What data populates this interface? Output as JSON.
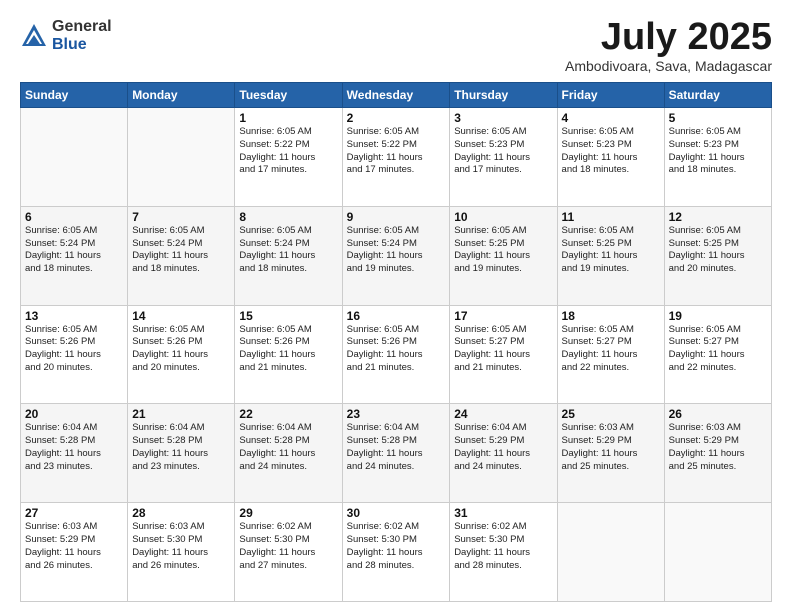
{
  "logo": {
    "general": "General",
    "blue": "Blue"
  },
  "title": "July 2025",
  "location": "Ambodivoara, Sava, Madagascar",
  "weekdays": [
    "Sunday",
    "Monday",
    "Tuesday",
    "Wednesday",
    "Thursday",
    "Friday",
    "Saturday"
  ],
  "weeks": [
    [
      {
        "day": "",
        "info": ""
      },
      {
        "day": "",
        "info": ""
      },
      {
        "day": "1",
        "info": "Sunrise: 6:05 AM\nSunset: 5:22 PM\nDaylight: 11 hours\nand 17 minutes."
      },
      {
        "day": "2",
        "info": "Sunrise: 6:05 AM\nSunset: 5:22 PM\nDaylight: 11 hours\nand 17 minutes."
      },
      {
        "day": "3",
        "info": "Sunrise: 6:05 AM\nSunset: 5:23 PM\nDaylight: 11 hours\nand 17 minutes."
      },
      {
        "day": "4",
        "info": "Sunrise: 6:05 AM\nSunset: 5:23 PM\nDaylight: 11 hours\nand 18 minutes."
      },
      {
        "day": "5",
        "info": "Sunrise: 6:05 AM\nSunset: 5:23 PM\nDaylight: 11 hours\nand 18 minutes."
      }
    ],
    [
      {
        "day": "6",
        "info": "Sunrise: 6:05 AM\nSunset: 5:24 PM\nDaylight: 11 hours\nand 18 minutes."
      },
      {
        "day": "7",
        "info": "Sunrise: 6:05 AM\nSunset: 5:24 PM\nDaylight: 11 hours\nand 18 minutes."
      },
      {
        "day": "8",
        "info": "Sunrise: 6:05 AM\nSunset: 5:24 PM\nDaylight: 11 hours\nand 18 minutes."
      },
      {
        "day": "9",
        "info": "Sunrise: 6:05 AM\nSunset: 5:24 PM\nDaylight: 11 hours\nand 19 minutes."
      },
      {
        "day": "10",
        "info": "Sunrise: 6:05 AM\nSunset: 5:25 PM\nDaylight: 11 hours\nand 19 minutes."
      },
      {
        "day": "11",
        "info": "Sunrise: 6:05 AM\nSunset: 5:25 PM\nDaylight: 11 hours\nand 19 minutes."
      },
      {
        "day": "12",
        "info": "Sunrise: 6:05 AM\nSunset: 5:25 PM\nDaylight: 11 hours\nand 20 minutes."
      }
    ],
    [
      {
        "day": "13",
        "info": "Sunrise: 6:05 AM\nSunset: 5:26 PM\nDaylight: 11 hours\nand 20 minutes."
      },
      {
        "day": "14",
        "info": "Sunrise: 6:05 AM\nSunset: 5:26 PM\nDaylight: 11 hours\nand 20 minutes."
      },
      {
        "day": "15",
        "info": "Sunrise: 6:05 AM\nSunset: 5:26 PM\nDaylight: 11 hours\nand 21 minutes."
      },
      {
        "day": "16",
        "info": "Sunrise: 6:05 AM\nSunset: 5:26 PM\nDaylight: 11 hours\nand 21 minutes."
      },
      {
        "day": "17",
        "info": "Sunrise: 6:05 AM\nSunset: 5:27 PM\nDaylight: 11 hours\nand 21 minutes."
      },
      {
        "day": "18",
        "info": "Sunrise: 6:05 AM\nSunset: 5:27 PM\nDaylight: 11 hours\nand 22 minutes."
      },
      {
        "day": "19",
        "info": "Sunrise: 6:05 AM\nSunset: 5:27 PM\nDaylight: 11 hours\nand 22 minutes."
      }
    ],
    [
      {
        "day": "20",
        "info": "Sunrise: 6:04 AM\nSunset: 5:28 PM\nDaylight: 11 hours\nand 23 minutes."
      },
      {
        "day": "21",
        "info": "Sunrise: 6:04 AM\nSunset: 5:28 PM\nDaylight: 11 hours\nand 23 minutes."
      },
      {
        "day": "22",
        "info": "Sunrise: 6:04 AM\nSunset: 5:28 PM\nDaylight: 11 hours\nand 24 minutes."
      },
      {
        "day": "23",
        "info": "Sunrise: 6:04 AM\nSunset: 5:28 PM\nDaylight: 11 hours\nand 24 minutes."
      },
      {
        "day": "24",
        "info": "Sunrise: 6:04 AM\nSunset: 5:29 PM\nDaylight: 11 hours\nand 24 minutes."
      },
      {
        "day": "25",
        "info": "Sunrise: 6:03 AM\nSunset: 5:29 PM\nDaylight: 11 hours\nand 25 minutes."
      },
      {
        "day": "26",
        "info": "Sunrise: 6:03 AM\nSunset: 5:29 PM\nDaylight: 11 hours\nand 25 minutes."
      }
    ],
    [
      {
        "day": "27",
        "info": "Sunrise: 6:03 AM\nSunset: 5:29 PM\nDaylight: 11 hours\nand 26 minutes."
      },
      {
        "day": "28",
        "info": "Sunrise: 6:03 AM\nSunset: 5:30 PM\nDaylight: 11 hours\nand 26 minutes."
      },
      {
        "day": "29",
        "info": "Sunrise: 6:02 AM\nSunset: 5:30 PM\nDaylight: 11 hours\nand 27 minutes."
      },
      {
        "day": "30",
        "info": "Sunrise: 6:02 AM\nSunset: 5:30 PM\nDaylight: 11 hours\nand 28 minutes."
      },
      {
        "day": "31",
        "info": "Sunrise: 6:02 AM\nSunset: 5:30 PM\nDaylight: 11 hours\nand 28 minutes."
      },
      {
        "day": "",
        "info": ""
      },
      {
        "day": "",
        "info": ""
      }
    ]
  ]
}
